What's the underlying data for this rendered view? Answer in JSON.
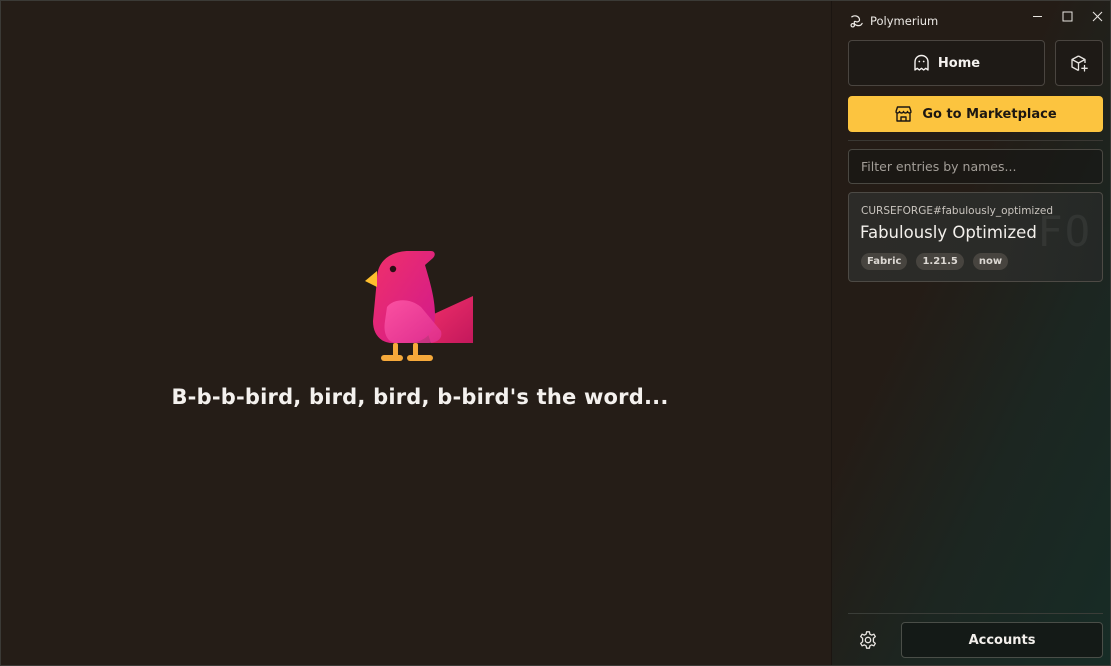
{
  "app": {
    "title": "Polymerium"
  },
  "main": {
    "message": "B-b-b-bird, bird, bird, b-bird's the word..."
  },
  "sidebar": {
    "home_label": "Home",
    "marketplace_label": "Go to Marketplace",
    "filter": {
      "value": "",
      "placeholder": "Filter entries by names..."
    },
    "entries": [
      {
        "key": "CURSEFORGE#fabulously_optimized",
        "name": "Fabulously Optimized",
        "watermark": "FO",
        "tags": [
          "Fabric",
          "1.21.5",
          "now"
        ]
      }
    ],
    "accounts_label": "Accounts"
  },
  "colors": {
    "accent": "#fcc43f",
    "background": "#251d17"
  }
}
